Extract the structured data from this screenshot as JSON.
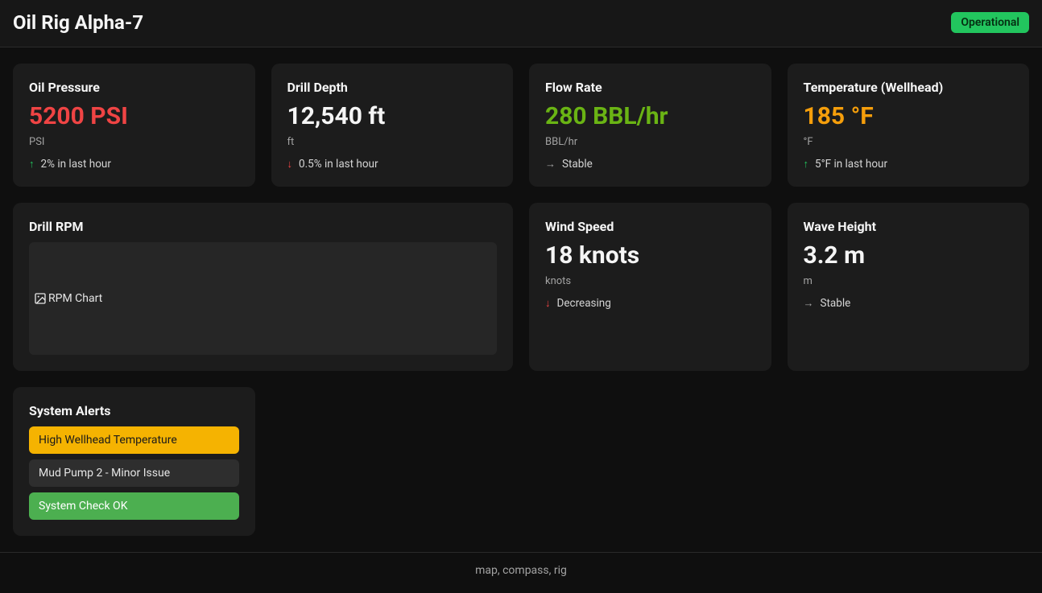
{
  "header": {
    "title": "Oil Rig Alpha-7",
    "status": "Operational"
  },
  "cards": {
    "oil_pressure": {
      "title": "Oil Pressure",
      "value": "5200 PSI",
      "unit": "PSI",
      "trend_icon": "up",
      "trend_text": "2% in last hour"
    },
    "drill_depth": {
      "title": "Drill Depth",
      "value": "12,540 ft",
      "unit": "ft",
      "trend_icon": "down",
      "trend_text": "0.5% in last hour"
    },
    "flow_rate": {
      "title": "Flow Rate",
      "value": "280 BBL/hr",
      "unit": "BBL/hr",
      "trend_icon": "right",
      "trend_text": "Stable"
    },
    "temperature": {
      "title": "Temperature (Wellhead)",
      "value": "185 °F",
      "unit": "°F",
      "trend_icon": "up",
      "trend_text": "5°F in last hour"
    },
    "drill_rpm": {
      "title": "Drill RPM",
      "chart_alt": "RPM Chart"
    },
    "wind_speed": {
      "title": "Wind Speed",
      "value": "18 knots",
      "unit": "knots",
      "trend_icon": "down",
      "trend_text": "Decreasing"
    },
    "wave_height": {
      "title": "Wave Height",
      "value": "3.2 m",
      "unit": "m",
      "trend_icon": "right",
      "trend_text": "Stable"
    },
    "alerts": {
      "title": "System Alerts",
      "items": [
        {
          "label": "High Wellhead Temperature",
          "severity": "warning"
        },
        {
          "label": "Mud Pump 2 - Minor Issue",
          "severity": "info"
        },
        {
          "label": "System Check OK",
          "severity": "success"
        }
      ]
    }
  },
  "footer": {
    "text": "map, compass, rig"
  },
  "icons": {
    "up": "↑",
    "down": "↓",
    "right": "→"
  }
}
